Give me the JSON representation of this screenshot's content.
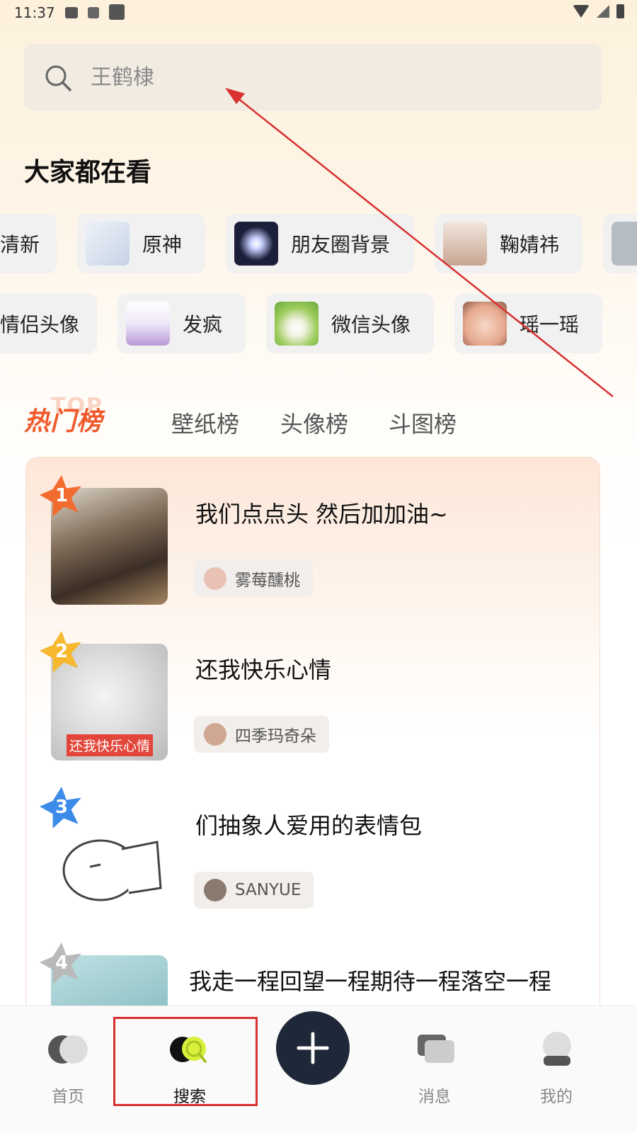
{
  "status_bar": {
    "time": "11:37"
  },
  "search": {
    "placeholder": "王鹤棣"
  },
  "section_title": "大家都在看",
  "chips_row1": [
    {
      "label": "清新",
      "color": "#d9e7d0"
    },
    {
      "label": "原神",
      "color": "#dfe7f2"
    },
    {
      "label": "朋友圈背景",
      "color": "#1b1f3a"
    },
    {
      "label": "鞠婧祎",
      "color": "#e9d9cf"
    },
    {
      "label": "",
      "color": "#c8ccd2"
    }
  ],
  "chips_row2": [
    {
      "label": "情侣头像",
      "color": "#e5d8cf"
    },
    {
      "label": "发疯",
      "color": "#ece4f4"
    },
    {
      "label": "微信头像",
      "color": "#b8d88a"
    },
    {
      "label": "瑶一瑶",
      "color": "#e8b9a2"
    }
  ],
  "tabs": {
    "hot_logo": "热门榜",
    "hot_logo_bg": "TOP",
    "items": [
      "壁纸榜",
      "头像榜",
      "斗图榜"
    ]
  },
  "ranking": [
    {
      "rank": "1",
      "title": "我们点点头  然后加加油~",
      "author": "雾莓醺桃",
      "star_color": "#f26b2f",
      "thumb_color": "#5b4a3c",
      "avatar_color": "#e9c2b5"
    },
    {
      "rank": "2",
      "title": "还我快乐心情",
      "author": "四季玛奇朵",
      "star_color": "#f5b82e",
      "thumb_color": "#e9e9e9",
      "avatar_color": "#cfa792",
      "thumb_caption": "还我快乐心情"
    },
    {
      "rank": "3",
      "title": "们抽象人爱用的表情包",
      "author": "SANYUE",
      "star_color": "#3d8be8",
      "thumb_color": "#ffffff",
      "avatar_color": "#8a7a70"
    },
    {
      "rank": "4",
      "title": "我走一程回望一程期待一程落空一程",
      "author": "",
      "star_color": "#b9b9b9",
      "thumb_color": "#9cc7cc",
      "avatar_color": "#cccccc"
    }
  ],
  "bottom_nav": {
    "items": [
      {
        "label": "首页",
        "active": false
      },
      {
        "label": "搜索",
        "active": true
      },
      {
        "label": "消息",
        "active": false
      },
      {
        "label": "我的",
        "active": false
      }
    ]
  },
  "colors": {
    "accent": "#ef5a2b",
    "annotation": "#d93030",
    "add_button": "#1f2838"
  }
}
